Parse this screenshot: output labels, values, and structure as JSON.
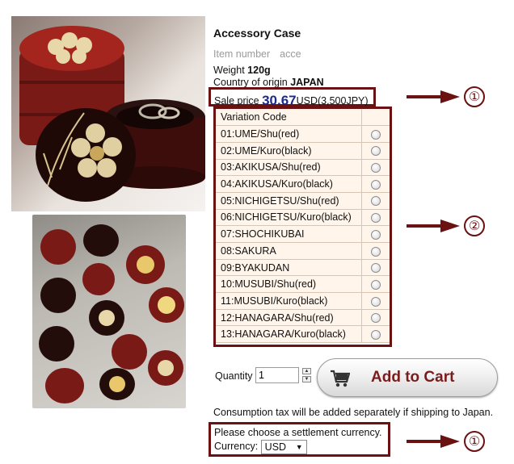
{
  "product": {
    "title": "Accessory Case",
    "item_number_label": "Item number",
    "item_number_value": "acce",
    "weight_label": "Weight",
    "weight_value": "120g",
    "origin_label": "Country of origin",
    "origin_value": "JAPAN"
  },
  "price": {
    "label": "Sale price",
    "value": "30.67",
    "currency_and_yen": "USD(3,500JPY)"
  },
  "variations": {
    "header": "Variation Code",
    "options": [
      "01:UME/Shu(red)",
      "02:UME/Kuro(black)",
      "03:AKIKUSA/Shu(red)",
      "04:AKIKUSA/Kuro(black)",
      "05:NICHIGETSU/Shu(red)",
      "06:NICHIGETSU/Kuro(black)",
      "07:SHOCHIKUBAI",
      "08:SAKURA",
      "09:BYAKUDAN",
      "10:MUSUBI/Shu(red)",
      "11:MUSUBI/Kuro(black)",
      "12:HANAGARA/Shu(red)",
      "13:HANAGARA/Kuro(black)"
    ]
  },
  "order": {
    "quantity_label": "Quantity",
    "quantity_value": "1",
    "add_to_cart_label": "Add to Cart"
  },
  "tax_note": "Consumption tax will be added separately if shipping to Japan.",
  "currency": {
    "prompt": "Please choose a settlement currency.",
    "label": "Currency:",
    "selected": "USD"
  },
  "annotations": {
    "marker_1": "①",
    "marker_2": "②",
    "color": "#6a1111"
  }
}
